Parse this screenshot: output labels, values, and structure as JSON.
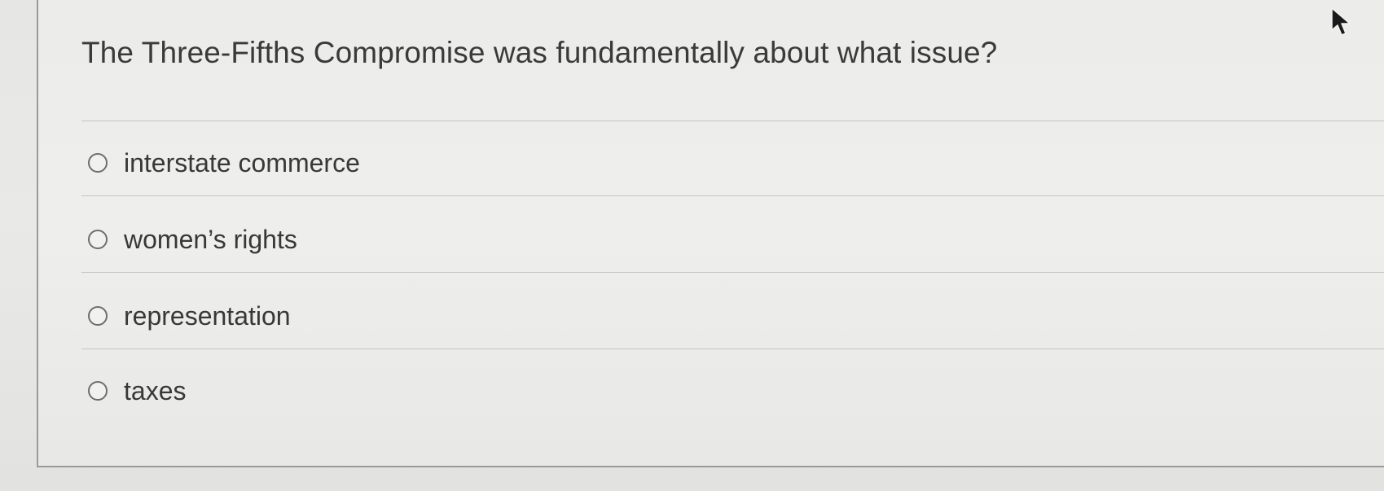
{
  "question": {
    "text": "The Three-Fifths Compromise was fundamentally about what issue?"
  },
  "options": [
    {
      "label": "interstate commerce",
      "selected": false
    },
    {
      "label": "women’s rights",
      "selected": false
    },
    {
      "label": "representation",
      "selected": false
    },
    {
      "label": "taxes",
      "selected": false
    }
  ],
  "cursor": {
    "icon": "mouse-pointer-icon"
  },
  "colors": {
    "background": "#e9e9e7",
    "text": "#3a3a3a",
    "radio_border": "#6e6e6e",
    "divider": "#c4c4c2"
  }
}
